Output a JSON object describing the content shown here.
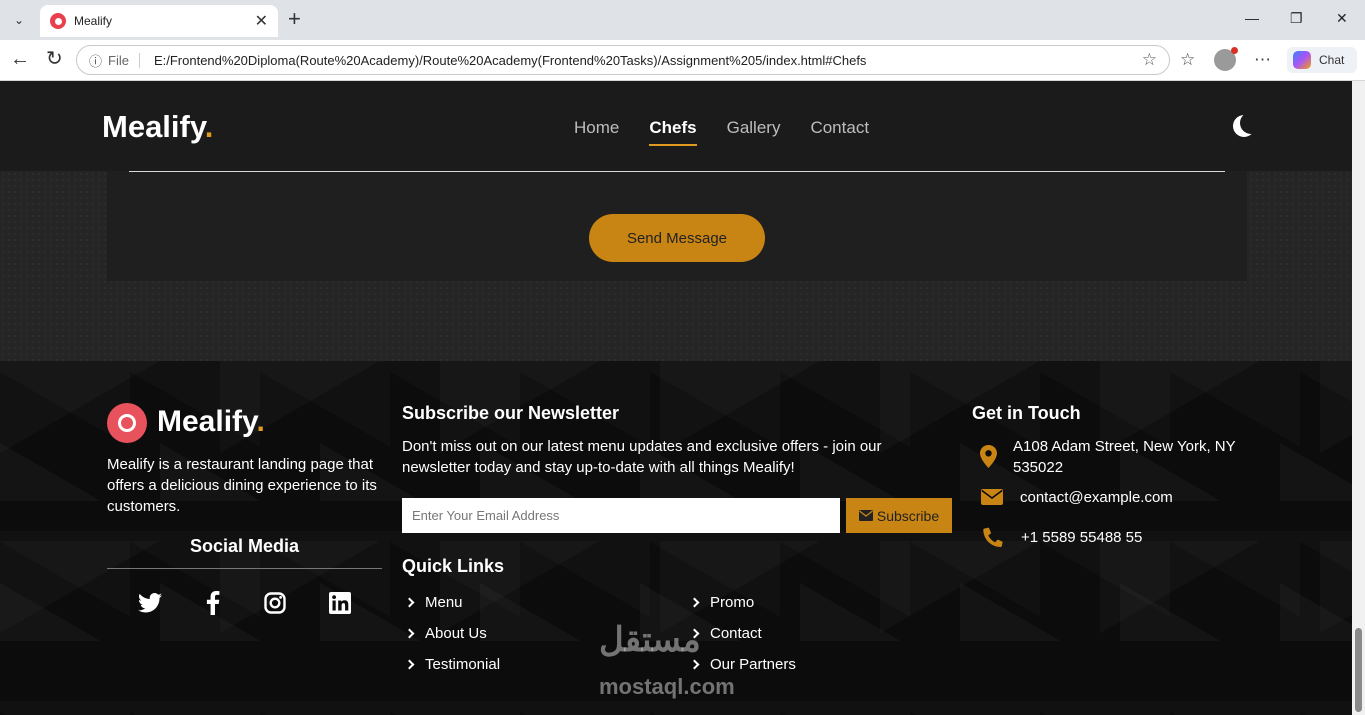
{
  "browser": {
    "tab_title": "Mealify",
    "file_label": "File",
    "url": "E:/Frontend%20Diploma(Route%20Academy)/Route%20Academy(Frontend%20Tasks)/Assignment%205/index.html#Chefs",
    "chat_label": "Chat"
  },
  "header": {
    "brand": "Mealify",
    "brand_dot": ".",
    "nav": [
      {
        "label": "Home"
      },
      {
        "label": "Chefs"
      },
      {
        "label": "Gallery"
      },
      {
        "label": "Contact"
      }
    ]
  },
  "contact_form": {
    "send_label": "Send Message"
  },
  "footer": {
    "brand": "Mealify",
    "brand_dot": ".",
    "description": "Mealify is a restaurant landing page that offers a delicious dining experience to its customers.",
    "social_title": "Social Media",
    "social": [
      {
        "icon": "twitter-icon"
      },
      {
        "icon": "facebook-icon"
      },
      {
        "icon": "instagram-icon"
      },
      {
        "icon": "linkedin-icon"
      }
    ],
    "newsletter": {
      "title": "Subscribe our Newsletter",
      "text": "Don't miss out on our latest menu updates and exclusive offers - join our newsletter today and stay up-to-date with all things Mealify!",
      "email_placeholder": "Enter Your Email Address",
      "subscribe_label": "Subscribe"
    },
    "quick_links": {
      "title": "Quick Links",
      "items": [
        "Menu",
        "About Us",
        "Testimonial",
        "Promo",
        "Contact",
        "Our Partners"
      ]
    },
    "touch": {
      "title": "Get in Touch",
      "address": "A108 Adam Street, New York, NY 535022",
      "email": "contact@example.com",
      "phone": "+1 5589 55488 55"
    }
  },
  "watermark": {
    "arabic": "مستقل",
    "latin": "mostaql.com"
  },
  "colors": {
    "accent": "#c98514",
    "brand_dot": "#e09b1e",
    "logo_red": "#e8525c"
  }
}
